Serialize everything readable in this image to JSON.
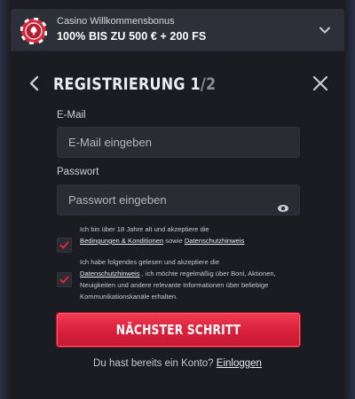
{
  "bonus": {
    "title": "Casino Willkommensbonus",
    "amount": "100% BIS ZU 500 € + 200 FS",
    "icon": "poker-chip-icon"
  },
  "step": {
    "title": "REGISTRIERUNG",
    "current": "1",
    "total": "/2"
  },
  "form": {
    "email_label": "E-Mail",
    "email_placeholder": "E-Mail eingeben",
    "email_value": "",
    "password_label": "Passwort",
    "password_placeholder": "Passwort eingeben",
    "password_value": ""
  },
  "consents": [
    {
      "checked": true,
      "text_1": "Ich bin über 18 Jahre alt und akzeptiere die",
      "link_1": "Bedingungen & Konditionen",
      "text_2": " sowie ",
      "link_2": "Datenschutzhinweis"
    },
    {
      "checked": true,
      "text_1": "Ich habe folgendes gelesen und akzeptiere die",
      "link_1": "Datenschutzhinweis",
      "text_2": " , ich möchte regelmäßig über Boni, Aktionen, Neuigkeiten und andere relevante Informationen über beliebige Kommunikationskanäle erhalten."
    }
  ],
  "actions": {
    "next_label": "NÄCHSTER SCHRITT",
    "login_prompt": "Du hast bereits ein Konto?",
    "login_link": "Einloggen"
  },
  "colors": {
    "accent": "#e0243f",
    "checkmark": "#e0243f",
    "background": "#1b1c21"
  }
}
